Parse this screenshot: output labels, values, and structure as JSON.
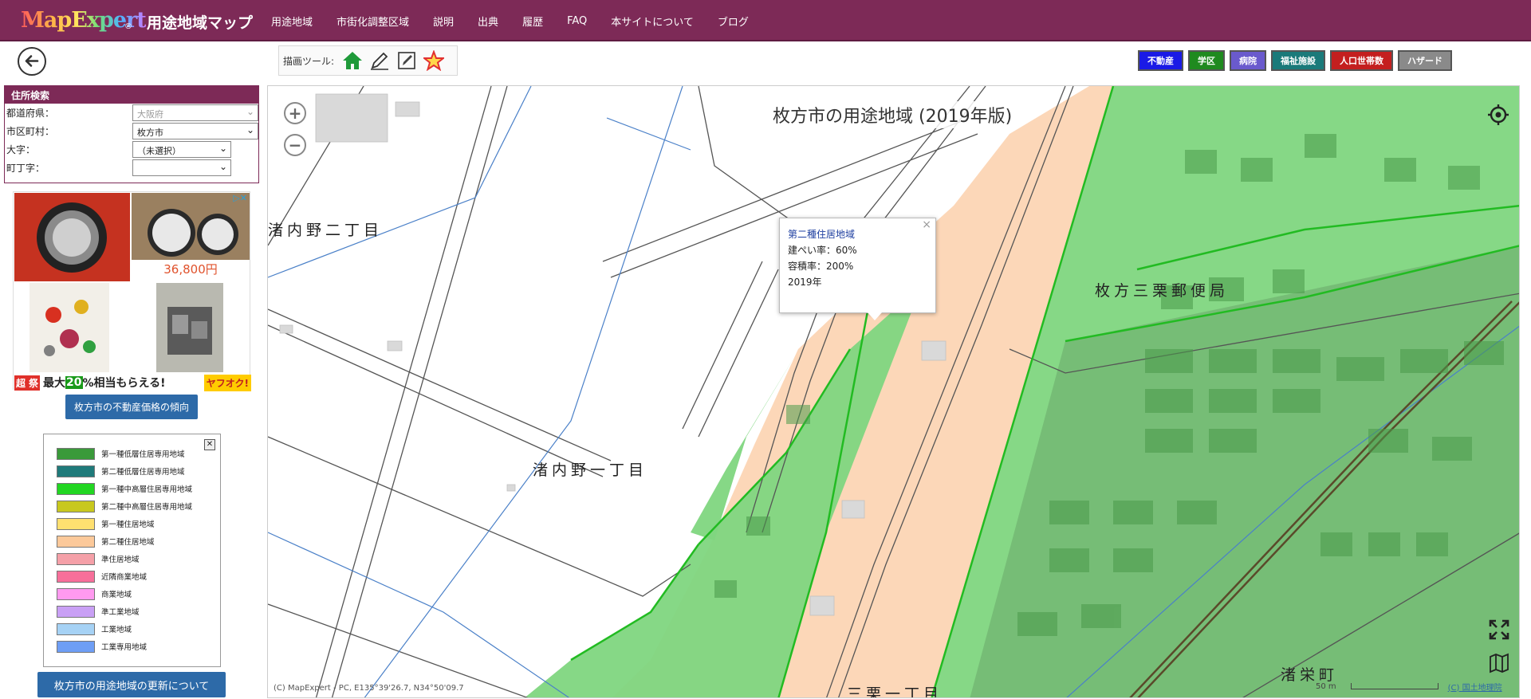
{
  "header": {
    "logo": "MapExpert",
    "logo_reg": "®",
    "title": "用途地域マップ",
    "nav": [
      "用途地域",
      "市街化調整区域",
      "説明",
      "出典",
      "履歴",
      "FAQ",
      "本サイトについて",
      "ブログ"
    ]
  },
  "toolbar": {
    "label": "描画ツール:",
    "tools": [
      "house-icon",
      "pencil-icon",
      "marker-icon",
      "star-icon"
    ]
  },
  "layers": [
    {
      "label": "不動産",
      "color": "#1a1ae6"
    },
    {
      "label": "学区",
      "color": "#1f8a1f"
    },
    {
      "label": "病院",
      "color": "#6a5acd"
    },
    {
      "label": "福祉施設",
      "color": "#1a7a7a"
    },
    {
      "label": "人口世帯数",
      "color": "#c41f1f"
    },
    {
      "label": "ハザード",
      "color": "#8a8a8a"
    }
  ],
  "address": {
    "title": "住所検索",
    "rows": [
      {
        "label": "都道府県：",
        "value": "大阪府"
      },
      {
        "label": "市区町村：",
        "value": "枚方市"
      },
      {
        "label": "大字：",
        "value": "（未選択）"
      },
      {
        "label": "町丁字：",
        "value": ""
      }
    ]
  },
  "ad": {
    "price": "36,800円",
    "banner_a": "超",
    "banner_b": "祭",
    "banner_text_1": "最大",
    "banner_number": "20",
    "banner_text_2": "%相当もらえる!",
    "banner_brand": "ヤフオク!"
  },
  "price_button": "枚方市の不動産価格の傾向",
  "legend": {
    "items": [
      {
        "label": "第一種低層住居専用地域",
        "color": "#3a9a3a"
      },
      {
        "label": "第二種低層住居専用地域",
        "color": "#1f7a7a"
      },
      {
        "label": "第一種中高層住居専用地域",
        "color": "#22d622"
      },
      {
        "label": "第二種中高層住居専用地域",
        "color": "#c8c81e"
      },
      {
        "label": "第一種住居地域",
        "color": "#ffe070"
      },
      {
        "label": "第二種住居地域",
        "color": "#fcc99a"
      },
      {
        "label": "準住居地域",
        "color": "#f5a0a8"
      },
      {
        "label": "近隣商業地域",
        "color": "#f76f9a"
      },
      {
        "label": "商業地域",
        "color": "#ff9af0"
      },
      {
        "label": "準工業地域",
        "color": "#c9a0f5"
      },
      {
        "label": "工業地域",
        "color": "#a6d2f5"
      },
      {
        "label": "工業専用地域",
        "color": "#6e9ef5"
      }
    ]
  },
  "update_button": "枚方市の用途地域の更新について",
  "map": {
    "title": "枚方市の用途地域 (2019年版)",
    "popup": {
      "title": "第二種住居地域",
      "line1": "建ぺい率：60%",
      "line2": "容積率：200%",
      "line3": "2019年"
    },
    "labels": {
      "area1": "渚内野二丁目",
      "area2": "渚内野一丁目",
      "area3": "枚方三栗郵便局",
      "area4": "渚栄町",
      "area5": "三栗一丁目"
    },
    "attribution": "(C) MapExpert - PC, E135°39'26.7, N34°50'09.7",
    "scale": "50 m",
    "gsi": "(C) 国土地理院"
  }
}
